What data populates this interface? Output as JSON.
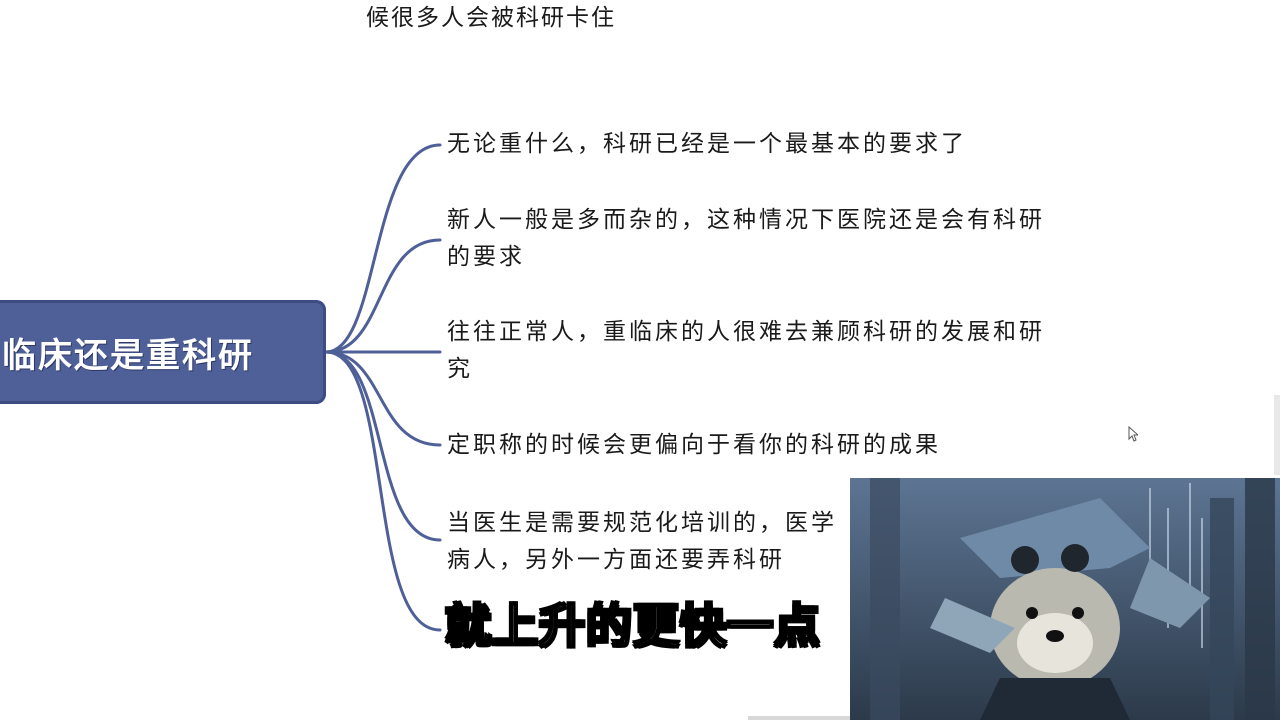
{
  "top_caption": "候很多人会被科研卡住",
  "mindmap": {
    "root": "临床还是重科研",
    "branches": [
      "无论重什么，科研已经是一个最基本的要求了",
      "新人一般是多而杂的，这种情况下医院还是会有科研\n的要求",
      "往往正常人，重临床的人很难去兼顾科研的发展和研\n究",
      "定职称的时候会更偏向于看你的科研的成果",
      "当医生是需要规范化培训的，医学\n病人，另外一方面还要弄科研"
    ]
  },
  "subtitle": "就上升的更快一点",
  "colors": {
    "root_fill": "#4f5f97",
    "connector": "#4f5f97",
    "text": "#1a1a1a"
  }
}
